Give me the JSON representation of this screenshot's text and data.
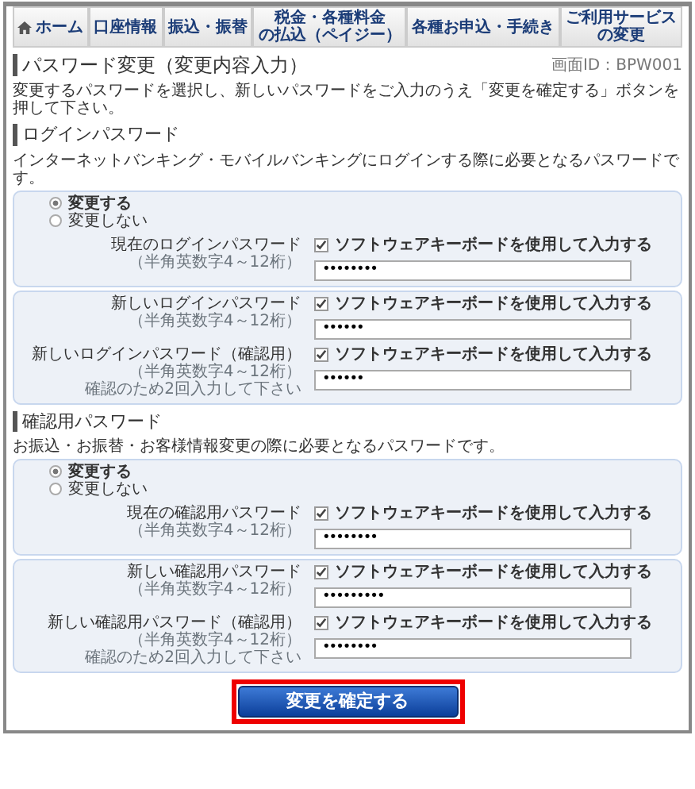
{
  "nav_tabs": [
    {
      "kind": "home",
      "label": "ホーム"
    },
    {
      "kind": "text",
      "lines": [
        "口座情報"
      ]
    },
    {
      "kind": "text",
      "lines": [
        "振込・振替"
      ]
    },
    {
      "kind": "text",
      "lines": [
        "税金・各種料金",
        "の払込（ペイジー）"
      ]
    },
    {
      "kind": "text",
      "lines": [
        "各種お申込・手続き"
      ]
    },
    {
      "kind": "text",
      "lines": [
        "ご利用サービス",
        "の変更"
      ]
    }
  ],
  "page_title": "パスワード変更（変更内容入力）",
  "screen_id": "画面ID：BPW001",
  "description": "変更するパスワードを選択し、新しいパスワードをご入力のうえ「変更を確定する」ボタンを押して下さい。",
  "sections": [
    {
      "heading": "ログインパスワード",
      "description": "インターネットバンキング・モバイルバンキングにログインする際に必要となるパスワードです。",
      "options": [
        {
          "label": "変更する",
          "selected": true
        },
        {
          "label": "変更しない",
          "selected": false
        }
      ],
      "groups": [
        [
          {
            "label": "現在のログインパスワード",
            "notes": [
              "（半角英数字4～12桁）"
            ],
            "keyboard_label": "ソフトウェアキーボードを使用して入力する",
            "keyboard_checked": true,
            "value": "••••••••"
          }
        ],
        [
          {
            "label": "新しいログインパスワード",
            "notes": [
              "（半角英数字4～12桁）"
            ],
            "keyboard_label": "ソフトウェアキーボードを使用して入力する",
            "keyboard_checked": true,
            "value": "••••••"
          },
          {
            "label": "新しいログインパスワード（確認用）",
            "notes": [
              "（半角英数字4～12桁）",
              "確認のため2回入力して下さい"
            ],
            "keyboard_label": "ソフトウェアキーボードを使用して入力する",
            "keyboard_checked": true,
            "value": "••••••"
          }
        ]
      ]
    },
    {
      "heading": "確認用パスワード",
      "description": "お振込・お振替・お客様情報変更の際に必要となるパスワードです。",
      "options": [
        {
          "label": "変更する",
          "selected": true
        },
        {
          "label": "変更しない",
          "selected": false
        }
      ],
      "groups": [
        [
          {
            "label": "現在の確認用パスワード",
            "notes": [
              "（半角英数字4～12桁）"
            ],
            "keyboard_label": "ソフトウェアキーボードを使用して入力する",
            "keyboard_checked": true,
            "value": "••••••••"
          }
        ],
        [
          {
            "label": "新しい確認用パスワード",
            "notes": [
              "（半角英数字4～12桁）"
            ],
            "keyboard_label": "ソフトウェアキーボードを使用して入力する",
            "keyboard_checked": true,
            "value": "•••••••••"
          },
          {
            "label": "新しい確認用パスワード（確認用）",
            "notes": [
              "（半角英数字4～12桁）",
              "確認のため2回入力して下さい"
            ],
            "keyboard_label": "ソフトウェアキーボードを使用して入力する",
            "keyboard_checked": true,
            "value": "••••••••"
          }
        ]
      ]
    }
  ],
  "submit_button": "変更を確定する"
}
